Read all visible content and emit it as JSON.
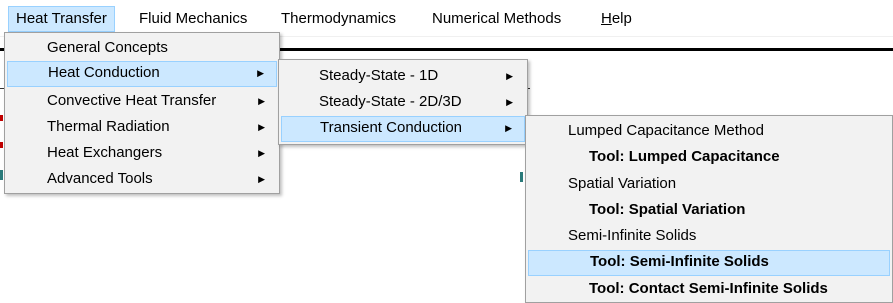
{
  "menubar": {
    "items": [
      {
        "label": "Heat Transfer"
      },
      {
        "label": "Fluid Mechanics"
      },
      {
        "label": "Thermodynamics"
      },
      {
        "label": "Numerical Methods"
      },
      {
        "label_prefix": "",
        "label_u": "H",
        "label_rest": "elp"
      }
    ]
  },
  "menu1": {
    "items": [
      {
        "label": "General Concepts"
      },
      {
        "label": "Heat Conduction"
      },
      {
        "label": "Convective Heat Transfer"
      },
      {
        "label": "Thermal Radiation"
      },
      {
        "label": "Heat Exchangers"
      },
      {
        "label": "Advanced Tools"
      }
    ]
  },
  "menu2": {
    "items": [
      {
        "label": "Steady-State - 1D"
      },
      {
        "label": "Steady-State - 2D/3D"
      },
      {
        "label": "Transient Conduction"
      }
    ]
  },
  "menu3": {
    "items": [
      {
        "label": "Lumped Capacitance Method"
      },
      {
        "label": "Tool: Lumped Capacitance"
      },
      {
        "label": "Spatial Variation"
      },
      {
        "label": "Tool: Spatial Variation"
      },
      {
        "label": "Semi-Infinite Solids"
      },
      {
        "label": "Tool: Semi-Infinite Solids"
      },
      {
        "label": "Tool: Contact Semi-Infinite Solids"
      }
    ]
  },
  "icons": {
    "submenu_arrow": "▶"
  },
  "colors": {
    "highlight": "#cce8ff",
    "highlight_border": "#99d1ff",
    "menu_bg": "#f2f2f2"
  }
}
